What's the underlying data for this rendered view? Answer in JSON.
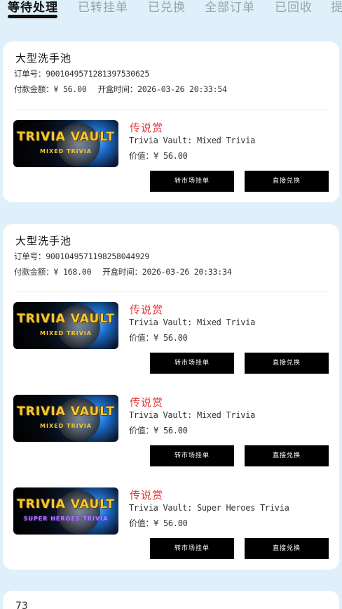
{
  "tabs": [
    {
      "label": "等待处理",
      "active": true
    },
    {
      "label": "已转挂单",
      "active": false
    },
    {
      "label": "已兑换",
      "active": false
    },
    {
      "label": "全部订单",
      "active": false
    },
    {
      "label": "已回收",
      "active": false
    },
    {
      "label": "提",
      "active": false
    }
  ],
  "labels": {
    "order_no": "订单号：",
    "amount": "付款金额：",
    "open_time": "开盒时间：",
    "value": "价值：",
    "list_button": "转市场挂单",
    "redeem_button": "直接兑换"
  },
  "orders": [
    {
      "title": "大型洗手池",
      "order_no": "90010495712813975306 25",
      "order_no_text": "900104957128139753062 5",
      "order_number": "9001049571281397530625",
      "amount": "¥ 56.00",
      "open_time": "2026-03-26 20:33:54",
      "items": [
        {
          "tier": "传说赏",
          "name": "Trivia Vault: Mixed Trivia",
          "value": "¥ 56.00",
          "thumb_title": "TRIVIA VAULT",
          "thumb_sub": "MIXED TRIVIA",
          "thumb_sub_color": "#f2c832"
        }
      ]
    },
    {
      "title": "大型洗手池",
      "order_number": "9001049571198258044929",
      "amount": "¥ 168.00",
      "open_time": "2026-03-26 20:33:34",
      "items": [
        {
          "tier": "传说赏",
          "name": "Trivia Vault: Mixed Trivia",
          "value": "¥ 56.00",
          "thumb_title": "TRIVIA VAULT",
          "thumb_sub": "MIXED TRIVIA",
          "thumb_sub_color": "#f2c832"
        },
        {
          "tier": "传说赏",
          "name": "Trivia Vault: Mixed Trivia",
          "value": "¥ 56.00",
          "thumb_title": "TRIVIA VAULT",
          "thumb_sub": "MIXED TRIVIA",
          "thumb_sub_color": "#f2c832"
        },
        {
          "tier": "传说赏",
          "name": "Trivia Vault: Super Heroes Trivia",
          "value": "¥ 56.00",
          "thumb_title": "TRIVIA VAULT",
          "thumb_sub": "SUPER HEROES TRIVIA",
          "thumb_sub_color": "#b27cff"
        }
      ]
    }
  ],
  "partial_card_text": "73",
  "colors": {
    "background": "#dff0fa",
    "tier_red": "#e03a3a",
    "button_black": "#000000"
  }
}
